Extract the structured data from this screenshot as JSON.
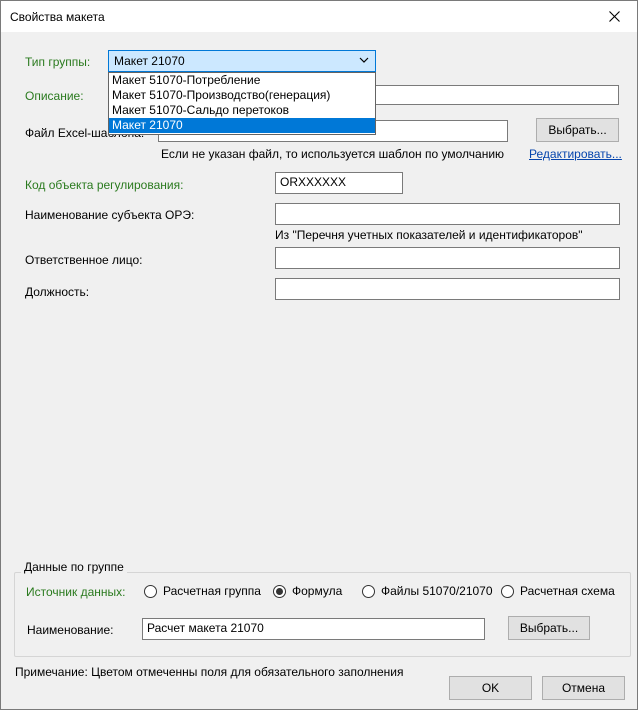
{
  "window": {
    "title": "Свойства макета"
  },
  "form": {
    "group_type_label": "Тип группы:",
    "group_type_value": "Макет 21070",
    "group_type_options": [
      "Макет 51070-Потребление",
      "Макет 51070-Производство(генерация)",
      "Макет 51070-Сальдо перетоков",
      "Макет 21070"
    ],
    "description_label": "Описание:",
    "description_value": "",
    "excel_label": "Файл Excel-шаблона:",
    "excel_value": "",
    "choose_label": "Выбрать...",
    "excel_hint": "Если не указан файл, то используется шаблон по умолчанию",
    "edit_link": "Редактировать...",
    "reg_code_label": "Код объекта регулирования:",
    "reg_code_value": "ORXXXXXX",
    "subject_label": "Наименование субъекта ОРЭ:",
    "subject_value": "",
    "subject_hint": "Из \"Перечня учетных показателей и идентификаторов\"",
    "responsible_label": "Ответственное лицо:",
    "responsible_value": "",
    "position_label": "Должность:",
    "position_value": ""
  },
  "group_data": {
    "title": "Данные по группе",
    "source_label": "Источник данных:",
    "radios": [
      "Расчетная группа",
      "Формула",
      "Файлы 51070/21070",
      "Расчетная схема"
    ],
    "selected_radio": "Формула",
    "name_label": "Наименование:",
    "name_value": "Расчет макета 21070",
    "choose_label": "Выбрать..."
  },
  "footer": {
    "note": "Примечание: Цветом отмеченны поля для обязательного заполнения",
    "ok_label": "OK",
    "cancel_label": "Отмена"
  },
  "colors": {
    "required": "#2a7a1e",
    "selection": "#0078d7",
    "link": "#0645ad"
  },
  "icons": {
    "close": "close-icon",
    "dropdown": "chevron-down-icon"
  }
}
